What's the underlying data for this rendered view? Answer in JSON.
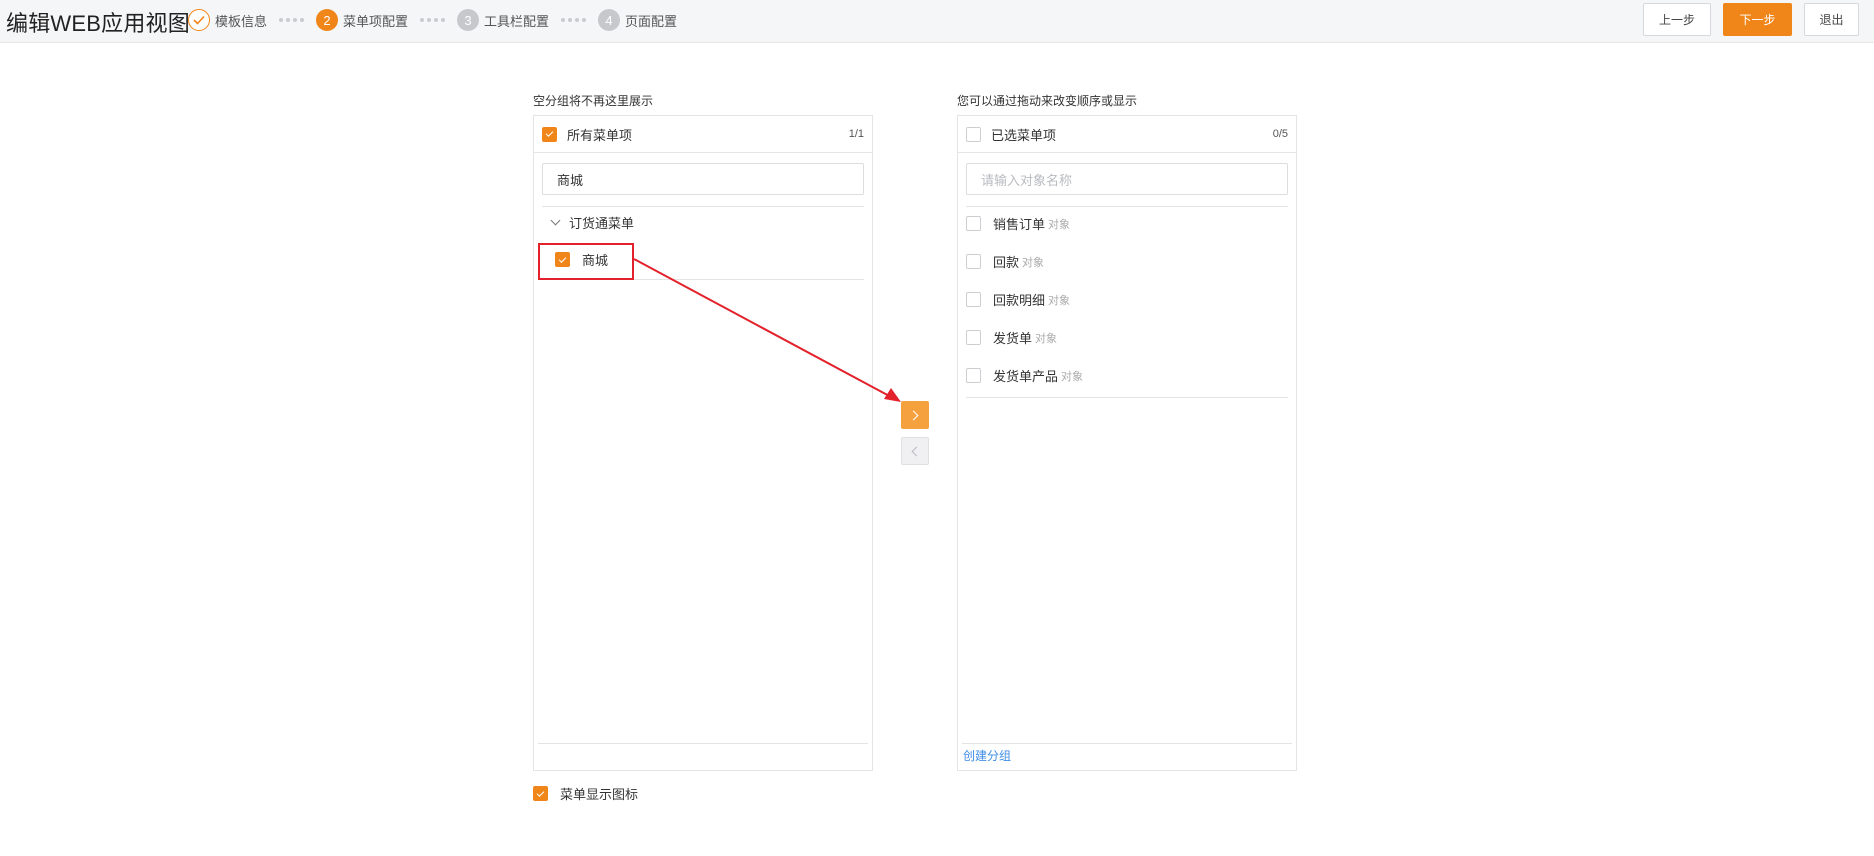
{
  "app": {
    "title": "编辑WEB应用视图"
  },
  "steps": [
    {
      "num": "",
      "label": "模板信息",
      "state": "done"
    },
    {
      "num": "2",
      "label": "菜单项配置",
      "state": "active"
    },
    {
      "num": "3",
      "label": "工具栏配置",
      "state": "todo"
    },
    {
      "num": "4",
      "label": "页面配置",
      "state": "todo"
    }
  ],
  "buttons": {
    "prev": "上一步",
    "next": "下一步",
    "exit": "退出"
  },
  "left_panel": {
    "caption": "空分组将不再这里展示",
    "header": "所有菜单项",
    "count": "1/1",
    "search_value": "商城",
    "group": "订货通菜单",
    "items": [
      {
        "label": "商城",
        "checked": true
      }
    ]
  },
  "right_panel": {
    "caption": "您可以通过拖动来改变顺序或显示",
    "header": "已选菜单项",
    "count": "0/5",
    "search_placeholder": "请输入对象名称",
    "items": [
      {
        "label": "销售订单",
        "tag": "对象"
      },
      {
        "label": "回款",
        "tag": "对象"
      },
      {
        "label": "回款明细",
        "tag": "对象"
      },
      {
        "label": "发货单",
        "tag": "对象"
      },
      {
        "label": "发货单产品",
        "tag": "对象"
      }
    ],
    "create_group": "创建分组"
  },
  "options": {
    "show_menu_icons": "菜单显示图标",
    "show_menu_icons_checked": true
  },
  "colors": {
    "accent": "#f08519",
    "annotation": "#e3212b",
    "link": "#3d8ee8"
  }
}
